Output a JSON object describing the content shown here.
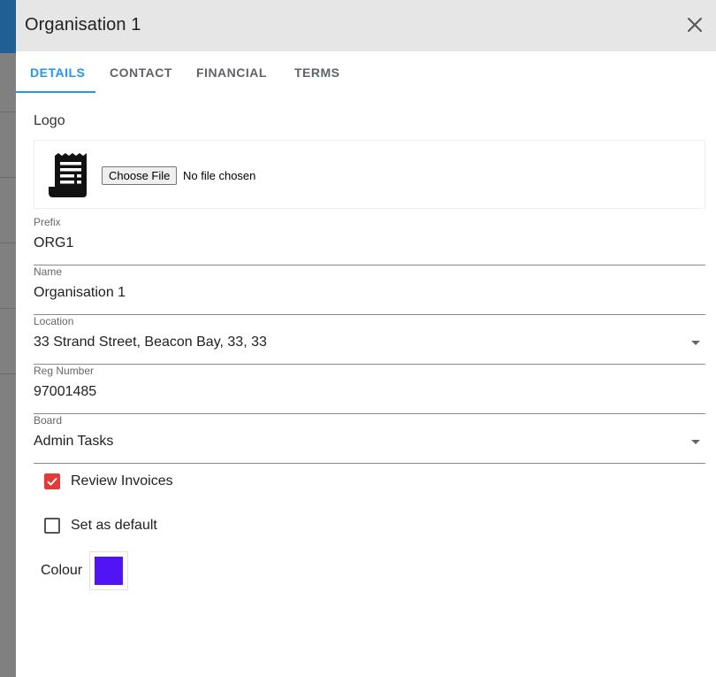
{
  "dialog": {
    "title": "Organisation 1"
  },
  "tabs": [
    {
      "label": "DETAILS",
      "active": true
    },
    {
      "label": "CONTACT",
      "active": false
    },
    {
      "label": "FINANCIAL",
      "active": false
    },
    {
      "label": "TERMS",
      "active": false
    }
  ],
  "logo": {
    "label": "Logo",
    "icon": "receipt-icon",
    "choose_file_label": "Choose File",
    "file_status": "No file chosen"
  },
  "fields": {
    "prefix": {
      "label": "Prefix",
      "value": "ORG1"
    },
    "name": {
      "label": "Name",
      "value": "Organisation 1"
    },
    "location": {
      "label": "Location",
      "value": "33 Strand Street, Beacon Bay, 33, 33"
    },
    "reg_number": {
      "label": "Reg Number",
      "value": "97001485"
    },
    "board": {
      "label": "Board",
      "value": "Admin Tasks"
    }
  },
  "checkboxes": {
    "review_invoices": {
      "label": "Review Invoices",
      "checked": true
    },
    "set_default": {
      "label": "Set as default",
      "checked": false
    }
  },
  "colour": {
    "label": "Colour",
    "value": "#5014f5"
  },
  "colors": {
    "accent": "#2196f3",
    "checkbox_checked": "#e53935"
  }
}
